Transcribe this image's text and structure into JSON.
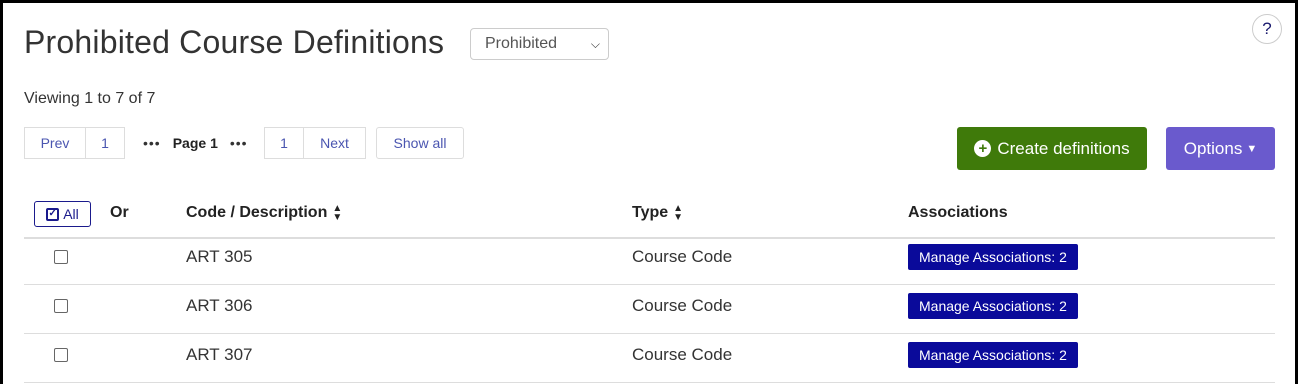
{
  "page": {
    "title": "Prohibited Course Definitions",
    "type_select": {
      "selected": "Prohibited"
    },
    "help_label": "?"
  },
  "viewing_text": "Viewing 1 to 7 of 7",
  "pagination": {
    "prev_label": "Prev",
    "first_page": "1",
    "dots": "•••",
    "current_label": "Page 1",
    "last_page": "1",
    "next_label": "Next",
    "show_all_label": "Show all"
  },
  "actions": {
    "create_label": "Create definitions",
    "options_label": "Options"
  },
  "table": {
    "all_label": "All",
    "headers": {
      "or": "Or",
      "code": "Code / Description",
      "type": "Type",
      "associations": "Associations"
    },
    "rows": [
      {
        "code": "ART 305",
        "type": "Course Code",
        "associations": "Manage Associations: 2"
      },
      {
        "code": "ART 306",
        "type": "Course Code",
        "associations": "Manage Associations: 2"
      },
      {
        "code": "ART 307",
        "type": "Course Code",
        "associations": "Manage Associations: 2"
      }
    ]
  },
  "colors": {
    "create_button": "#3f7a0a",
    "options_button": "#6a5acd",
    "associations_button": "#0a0a9a"
  }
}
